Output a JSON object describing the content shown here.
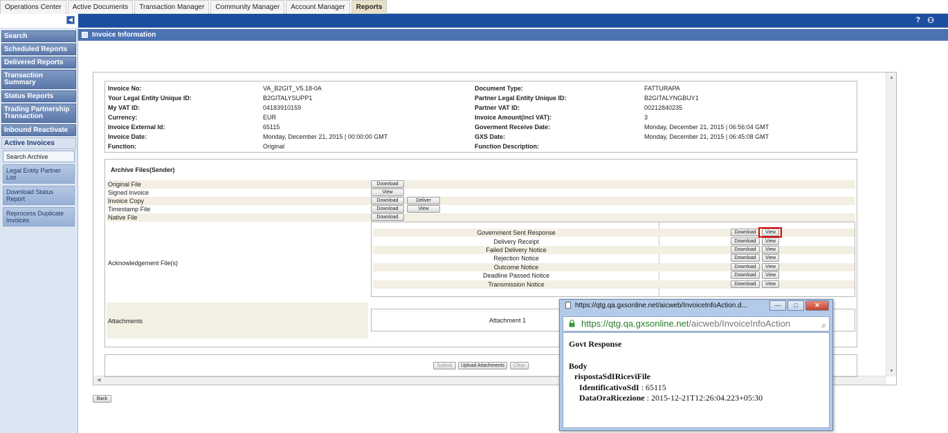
{
  "tabs": [
    {
      "label": "Operations Center",
      "active": false
    },
    {
      "label": "Active Documents",
      "active": false
    },
    {
      "label": "Transaction Manager",
      "active": false
    },
    {
      "label": "Community Manager",
      "active": false
    },
    {
      "label": "Account Manager",
      "active": false
    },
    {
      "label": "Reports",
      "active": true
    }
  ],
  "header": {
    "help_icon": "?",
    "users_icon": "⚇"
  },
  "sidebar": {
    "items": [
      {
        "label": "Search"
      },
      {
        "label": "Scheduled Reports"
      },
      {
        "label": "Delivered Reports"
      },
      {
        "label": "Transaction Summary"
      },
      {
        "label": "Status Reports"
      },
      {
        "label": "Trading Partnership Transaction"
      },
      {
        "label": "Inbound Reactivate"
      },
      {
        "label": "Active Invoices"
      }
    ],
    "subitems": [
      {
        "label": "Search Archive"
      },
      {
        "label": "Legal Entity Partner List"
      },
      {
        "label": "Download Status Report"
      },
      {
        "label": "Reprocess Duplicate Invoices"
      }
    ]
  },
  "section": {
    "title": "Invoice Information"
  },
  "invoice": {
    "left": [
      {
        "label": "Invoice No:",
        "value": "VA_B2GIT_V5.18-0A"
      },
      {
        "label": "Your Legal Entity Unique ID:",
        "value": "B2GITALYSUPP1"
      },
      {
        "label": "My VAT ID:",
        "value": "04183910159"
      },
      {
        "label": "Currency:",
        "value": "EUR"
      },
      {
        "label": "Invoice External Id:",
        "value": "65115"
      },
      {
        "label": "Invoice Date:",
        "value": "Monday, December 21, 2015 | 00:00:00 GMT"
      },
      {
        "label": "Function:",
        "value": "Original"
      }
    ],
    "right": [
      {
        "label": "Document Type:",
        "value": "FATTURAPA"
      },
      {
        "label": "Partner Legal Entity Unique ID:",
        "value": "B2GITALYNGBUY1"
      },
      {
        "label": "Partner VAT ID:",
        "value": "00212840235"
      },
      {
        "label": "Invoice Amount(incl VAT):",
        "value": "3"
      },
      {
        "label": "Goverment Receive Date:",
        "value": "Monday, December 21, 2015 | 06:56:04 GMT"
      },
      {
        "label": "GXS Date:",
        "value": "Monday, December 21, 2015 | 06:45:08 GMT"
      },
      {
        "label": "Function Description:",
        "value": ""
      }
    ]
  },
  "archive": {
    "title": "Archive Files(Sender)",
    "files": [
      {
        "name": "Original File",
        "buttons": [
          "Download"
        ]
      },
      {
        "name": "Signed Invoice",
        "buttons": [
          "View"
        ]
      },
      {
        "name": "Invoice Copy",
        "buttons": [
          "Download",
          "Deliver"
        ]
      },
      {
        "name": "Timestamp File",
        "buttons": [
          "Download",
          "View"
        ]
      },
      {
        "name": "Native File",
        "buttons": [
          "Download"
        ]
      }
    ],
    "ack_label": "Acknowledgement File(s)",
    "ack_files": [
      {
        "name": "Government Sent Response"
      },
      {
        "name": "Delivery Receipt"
      },
      {
        "name": "Failed Delivery Notice"
      },
      {
        "name": "Rejection Notice"
      },
      {
        "name": "Outcome Notice"
      },
      {
        "name": "Deadline Passed Notice"
      },
      {
        "name": "Transmission Notice"
      }
    ],
    "download_label": "Download",
    "view_label": "View",
    "attachments_label": "Attachments",
    "attachment_name": "Attachment 1"
  },
  "actions": {
    "submit": "Submit",
    "upload": "Upload Attachments",
    "clear": "Clear",
    "back": "Back"
  },
  "popup": {
    "title": "https://qtg.qa.gxsonline.net/aicweb/InvoiceInfoAction.d...",
    "url_host": "https://qtg.qa.gxsonline.net",
    "url_path": "/aicweb/InvoiceInfoAction",
    "heading": "Govt Response",
    "body_label": "Body",
    "root": "rispostaSdIRiceviFile",
    "fields": [
      {
        "key": "IdentificativoSdI",
        "value": " : 65115"
      },
      {
        "key": "DataOraRicezione",
        "value": " : 2015-12-21T12:26:04.223+05:30"
      }
    ],
    "colors": {
      "secure_green": "#2a7a2a"
    }
  }
}
